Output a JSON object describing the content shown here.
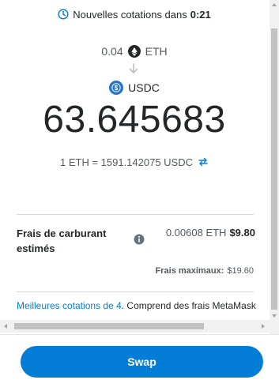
{
  "timer": {
    "label": "Nouvelles cotations dans",
    "countdown": "0:21"
  },
  "from": {
    "amount": "0.04",
    "symbol": "ETH"
  },
  "to": {
    "symbol": "USDC",
    "amount": "63.645683"
  },
  "rate": {
    "text": "1 ETH = 1591.142075 USDC"
  },
  "fees": {
    "label": "Frais de carburant estimés",
    "eth_value": "0.00608 ETH",
    "fiat_value": "$9.80",
    "max_label": "Frais maximaux:",
    "max_value": "$19.60"
  },
  "quotes": {
    "link_text": "Meilleures cotations de 4",
    "rest_text": ". Comprend des frais MetaMask"
  },
  "actions": {
    "swap_label": "Swap"
  },
  "colors": {
    "accent": "#037dd6",
    "usdc": "#2775ca",
    "text": "#24272a",
    "muted": "#535a61"
  },
  "icons": {
    "timer": "clock-icon",
    "eth": "eth-token-icon",
    "usdc": "usdc-token-icon",
    "direction": "arrow-down-icon",
    "rate_toggle": "swap-arrows-icon",
    "info": "info-icon"
  }
}
